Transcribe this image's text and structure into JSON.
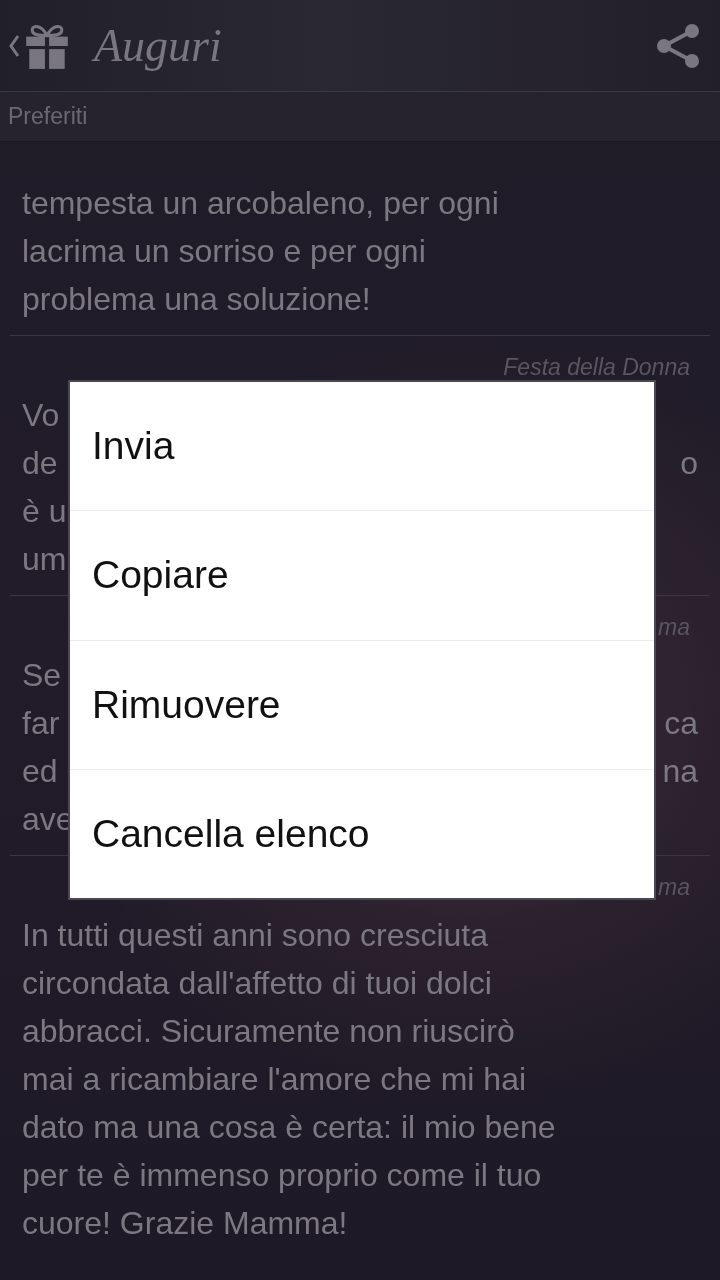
{
  "header": {
    "title": "Auguri"
  },
  "section": {
    "title": "Preferiti"
  },
  "cards": [
    {
      "kind": "full",
      "text": "tempesta un arcobaleno, per ogni\nlacrima un sorriso e per ogni\nproblema una soluzione!"
    },
    {
      "kind": "occluded",
      "tag": "Festa della Donna",
      "lines": [
        {
          "left": "Vo"
        },
        {
          "left": "de",
          "right": "o"
        },
        {
          "left": "è u"
        },
        {
          "left": "um"
        }
      ]
    },
    {
      "kind": "occluded",
      "tag": "ma",
      "lines": [
        {
          "left": "Se"
        },
        {
          "left": "far",
          "right": "ca"
        },
        {
          "left": "ed",
          "right": "na"
        },
        {
          "left": "ave"
        }
      ]
    },
    {
      "kind": "full",
      "tag": "ma",
      "text": "In tutti questi anni sono cresciuta\ncircondata dall'affetto di tuoi dolci\nabbracci. Sicuramente non riuscirò\nmai a ricambiare l'amore che mi hai\ndato ma una cosa è certa: il mio bene\nper te è immenso proprio come il tuo\ncuore! Grazie Mamma!"
    }
  ],
  "menu": {
    "items": [
      "Invia",
      "Copiare",
      "Rimuovere",
      "Cancella elenco"
    ]
  }
}
